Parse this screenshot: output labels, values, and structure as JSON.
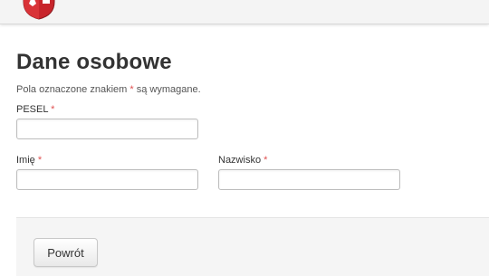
{
  "header": {
    "logo_icon": "coat-of-arms-icon"
  },
  "form": {
    "title": "Dane osobowe",
    "required_hint_before": "Pola oznaczone znakiem ",
    "required_marker": "*",
    "required_hint_after": " są wymagane.",
    "fields": {
      "pesel": {
        "label": "PESEL",
        "value": "",
        "placeholder": ""
      },
      "first_name": {
        "label": "Imię",
        "value": "",
        "placeholder": ""
      },
      "last_name": {
        "label": "Nazwisko",
        "value": "",
        "placeholder": ""
      }
    }
  },
  "actions": {
    "back_label": "Powrót"
  },
  "colors": {
    "required": "#e05050",
    "actions_background": "#f5f5f5"
  }
}
